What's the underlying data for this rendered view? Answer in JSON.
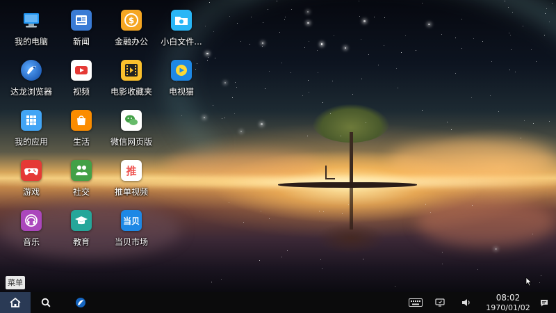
{
  "desktop": {
    "icons": [
      {
        "label": "我的电脑",
        "icon": "computer-icon",
        "color": "#1e88e5"
      },
      {
        "label": "新闻",
        "icon": "news-icon",
        "color": "#3a7bd5"
      },
      {
        "label": "金融办公",
        "icon": "finance-icon",
        "color": "#f5a623"
      },
      {
        "label": "小白文件...",
        "icon": "file-manager-icon",
        "color": "#29b6f6"
      },
      {
        "label": "达龙浏览器",
        "icon": "browser-icon",
        "color": "#1565c0"
      },
      {
        "label": "视频",
        "icon": "video-icon",
        "color": "#e53935"
      },
      {
        "label": "电影收藏夹",
        "icon": "film-icon",
        "color": "#fbc02d"
      },
      {
        "label": "电视猫",
        "icon": "tv-cat-icon",
        "color": "#1e88e5"
      },
      {
        "label": "我的应用",
        "icon": "apps-grid-icon",
        "color": "#42a5f5"
      },
      {
        "label": "生活",
        "icon": "shopping-bag-icon",
        "color": "#fb8c00"
      },
      {
        "label": "微信网页版",
        "icon": "wechat-icon",
        "color": "#ffffff"
      },
      {
        "label": "游戏",
        "icon": "gamepad-icon",
        "color": "#e53935"
      },
      {
        "label": "社交",
        "icon": "social-icon",
        "color": "#43a047"
      },
      {
        "label": "推单视频",
        "icon": "tuidan-video-icon",
        "color": "#ef5350"
      },
      {
        "label": "音乐",
        "icon": "music-icon",
        "color": "#ab47bc"
      },
      {
        "label": "教育",
        "icon": "education-icon",
        "color": "#26a69a"
      },
      {
        "label": "当贝市场",
        "icon": "dangbei-market-icon",
        "color": "#1e88e5"
      }
    ],
    "tuidan_glyph": "推",
    "dangbei_glyph": "当贝"
  },
  "menu_tag": "菜单",
  "taskbar": {
    "home_icon": "home-icon",
    "search_icon": "search-icon",
    "browser_icon": "browser-icon",
    "keyboard_icon": "keyboard-icon",
    "screen_icon": "screen-cast-icon",
    "volume_icon": "volume-icon",
    "time": "08:02",
    "date": "1970/01/02",
    "notification_icon": "notification-icon"
  }
}
